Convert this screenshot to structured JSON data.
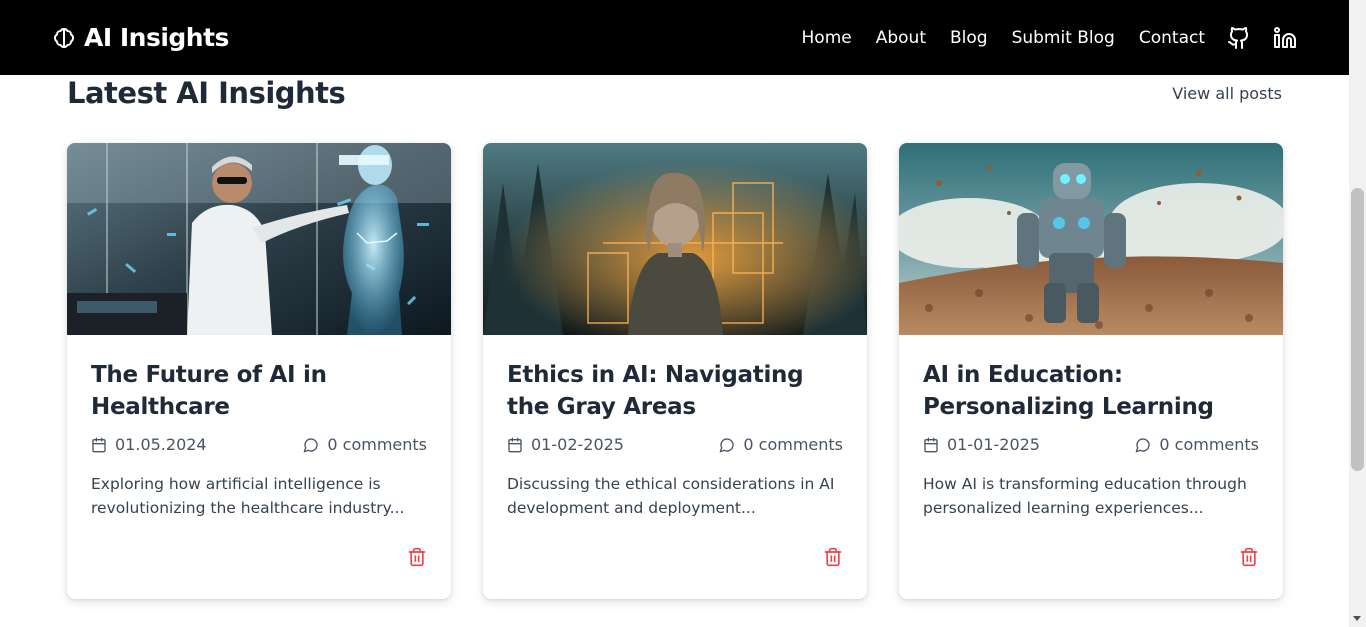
{
  "nav": {
    "brand": "AI Insights",
    "brand_icon": "brain-icon",
    "links": [
      "Home",
      "About",
      "Blog",
      "Submit Blog",
      "Contact"
    ],
    "icons": [
      "github-icon",
      "linkedin-icon"
    ]
  },
  "section": {
    "title": "Latest AI Insights",
    "view_all": "View all posts"
  },
  "posts": [
    {
      "title": "The Future of AI in Healthcare",
      "date": "01.05.2024",
      "comments": "0 comments",
      "excerpt": "Exploring how artificial intelligence is revolutionizing the healthcare industry...",
      "image": "doctor-hologram-image"
    },
    {
      "title": "Ethics in AI: Navigating the Gray Areas",
      "date": "01-02-2025",
      "comments": "0 comments",
      "excerpt": "Discussing the ethical considerations in AI development and deployment...",
      "image": "woman-forest-image"
    },
    {
      "title": "AI in Education: Personalizing Learning",
      "date": "01-01-2025",
      "comments": "0 comments",
      "excerpt": "How AI is transforming education through personalized learning experiences...",
      "image": "robot-coins-image"
    }
  ],
  "colors": {
    "navbar": "#000000",
    "delete": "#ef4444",
    "text": "#1f2937"
  }
}
